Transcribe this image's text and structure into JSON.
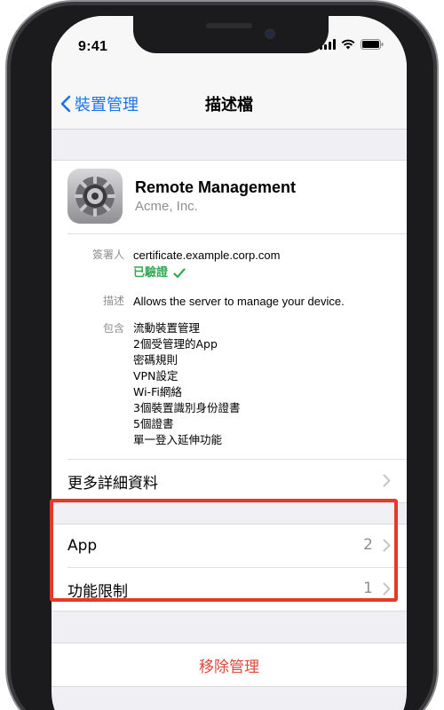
{
  "status_bar": {
    "time": "9:41"
  },
  "nav": {
    "back_label": "裝置管理",
    "title": "描述檔"
  },
  "profile": {
    "icon": "gear-icon",
    "name": "Remote Management",
    "organization": "Acme, Inc."
  },
  "details": {
    "signed_by_label": "簽署人",
    "signed_by_value": "certificate.example.corp.com",
    "verified_label": "已驗證",
    "description_label": "描述",
    "description_value": "Allows the server to manage your device.",
    "contains_label": "包含",
    "contains_items": [
      "流動裝置管理",
      "2個受管理的App",
      "密碼規則",
      "VPN設定",
      "Wi-Fi網絡",
      "3個裝置識別身份證書",
      "5個證書",
      "單一登入延伸功能"
    ]
  },
  "more_details": {
    "label": "更多詳細資料"
  },
  "managed_rows": [
    {
      "label": "App",
      "count": "2"
    },
    {
      "label": "功能限制",
      "count": "1"
    }
  ],
  "remove": {
    "label": "移除管理"
  },
  "colors": {
    "accent": "#1a73e8",
    "verified": "#34a853",
    "destructive": "#e0473e",
    "highlight": "#e23b28"
  }
}
